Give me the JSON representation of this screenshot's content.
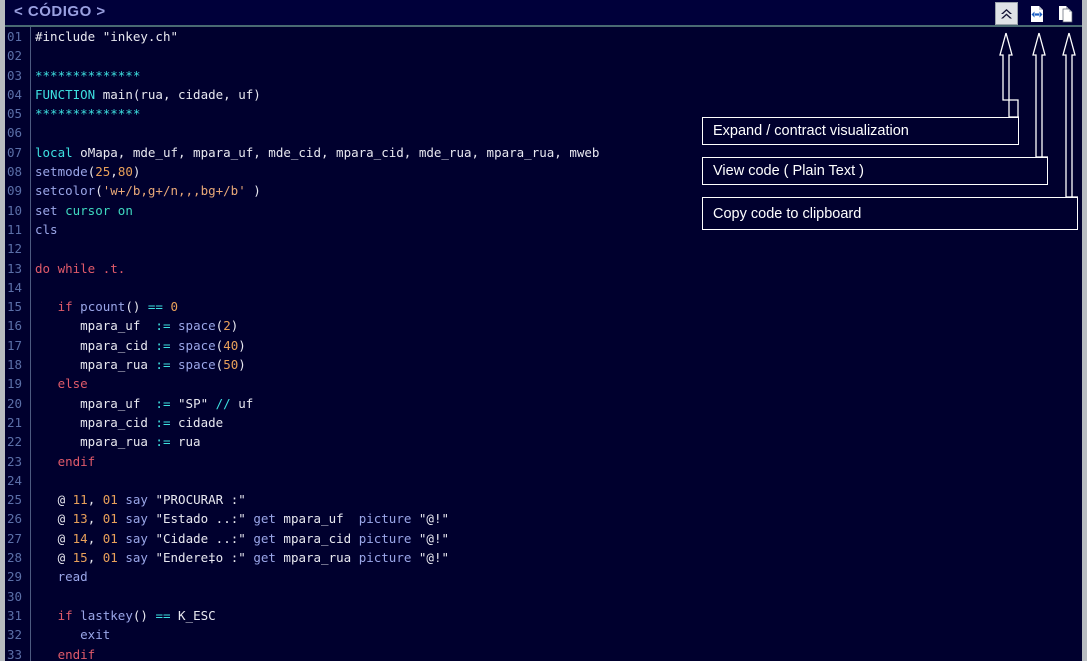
{
  "window": {
    "title": "< CÓDIGO >",
    "background_color": "#00002e",
    "title_color": "#9aa0e0",
    "border_color": "#b8bcc0"
  },
  "toolbar": {
    "buttons": [
      {
        "name": "expand-contract-button",
        "icon": "double-chevron-up-icon",
        "tooltip": "Expand / contract visualization"
      },
      {
        "name": "view-plain-text-button",
        "icon": "code-page-icon",
        "tooltip": "View code ( Plain Text )"
      },
      {
        "name": "copy-clipboard-button",
        "icon": "copy-pages-icon",
        "tooltip": "Copy code to clipboard"
      }
    ]
  },
  "callouts": [
    {
      "id": "callout-1",
      "label": "Expand / contract visualization"
    },
    {
      "id": "callout-2",
      "label": "View code ( Plain Text )"
    },
    {
      "id": "callout-3",
      "label": "Copy code to clipboard"
    }
  ],
  "editor": {
    "language": "Clipper / Harbour",
    "line_number_color": "#5b6fa8",
    "lines": [
      {
        "n": "01",
        "tokens": [
          {
            "t": "#include ",
            "c": "pl"
          },
          {
            "t": "\"inkey.ch\"",
            "c": "str"
          }
        ]
      },
      {
        "n": "02",
        "tokens": []
      },
      {
        "n": "03",
        "tokens": [
          {
            "t": "**************",
            "c": "cy"
          }
        ]
      },
      {
        "n": "04",
        "tokens": [
          {
            "t": "FUNCTION",
            "c": "cy"
          },
          {
            "t": " main(rua, cidade, uf)",
            "c": "pl"
          }
        ]
      },
      {
        "n": "05",
        "tokens": [
          {
            "t": "**************",
            "c": "cy"
          }
        ]
      },
      {
        "n": "06",
        "tokens": []
      },
      {
        "n": "07",
        "tokens": [
          {
            "t": "local",
            "c": "cy"
          },
          {
            "t": " oMapa, mde_uf, mpara_uf, mde_cid, mpara_cid, mde_rua, mpara_rua, mweb",
            "c": "pl"
          }
        ]
      },
      {
        "n": "08",
        "tokens": [
          {
            "t": "setmode",
            "c": "fn"
          },
          {
            "t": "(",
            "c": "pl"
          },
          {
            "t": "25",
            "c": "num"
          },
          {
            "t": ",",
            "c": "pl"
          },
          {
            "t": "80",
            "c": "num"
          },
          {
            "t": ")",
            "c": "pl"
          }
        ]
      },
      {
        "n": "09",
        "tokens": [
          {
            "t": "setcolor",
            "c": "fn"
          },
          {
            "t": "(",
            "c": "pl"
          },
          {
            "t": "'w+/b,g+/n,,,bg+/b'",
            "c": "str2"
          },
          {
            "t": " )",
            "c": "pl"
          }
        ]
      },
      {
        "n": "10",
        "tokens": [
          {
            "t": "set",
            "c": "fn"
          },
          {
            "t": " ",
            "c": "pl"
          },
          {
            "t": "cursor on",
            "c": "tl"
          }
        ]
      },
      {
        "n": "11",
        "tokens": [
          {
            "t": "cls",
            "c": "fn"
          }
        ]
      },
      {
        "n": "12",
        "tokens": []
      },
      {
        "n": "13",
        "tokens": [
          {
            "t": "do while",
            "c": "kw"
          },
          {
            "t": " ",
            "c": "pl"
          },
          {
            "t": ".t.",
            "c": "kw"
          }
        ]
      },
      {
        "n": "14",
        "tokens": []
      },
      {
        "n": "15",
        "tokens": [
          {
            "t": "   ",
            "c": "pl"
          },
          {
            "t": "if",
            "c": "kw"
          },
          {
            "t": " ",
            "c": "pl"
          },
          {
            "t": "pcount",
            "c": "fn"
          },
          {
            "t": "() ",
            "c": "pl"
          },
          {
            "t": "==",
            "c": "cy"
          },
          {
            "t": " ",
            "c": "pl"
          },
          {
            "t": "0",
            "c": "num"
          }
        ]
      },
      {
        "n": "16",
        "tokens": [
          {
            "t": "      mpara_uf  ",
            "c": "pl"
          },
          {
            "t": ":=",
            "c": "cy"
          },
          {
            "t": " ",
            "c": "pl"
          },
          {
            "t": "space",
            "c": "fn"
          },
          {
            "t": "(",
            "c": "pl"
          },
          {
            "t": "2",
            "c": "num"
          },
          {
            "t": ")",
            "c": "pl"
          }
        ]
      },
      {
        "n": "17",
        "tokens": [
          {
            "t": "      mpara_cid ",
            "c": "pl"
          },
          {
            "t": ":=",
            "c": "cy"
          },
          {
            "t": " ",
            "c": "pl"
          },
          {
            "t": "space",
            "c": "fn"
          },
          {
            "t": "(",
            "c": "pl"
          },
          {
            "t": "40",
            "c": "num"
          },
          {
            "t": ")",
            "c": "pl"
          }
        ]
      },
      {
        "n": "18",
        "tokens": [
          {
            "t": "      mpara_rua ",
            "c": "pl"
          },
          {
            "t": ":=",
            "c": "cy"
          },
          {
            "t": " ",
            "c": "pl"
          },
          {
            "t": "space",
            "c": "fn"
          },
          {
            "t": "(",
            "c": "pl"
          },
          {
            "t": "50",
            "c": "num"
          },
          {
            "t": ")",
            "c": "pl"
          }
        ]
      },
      {
        "n": "19",
        "tokens": [
          {
            "t": "   ",
            "c": "pl"
          },
          {
            "t": "else",
            "c": "kw"
          }
        ]
      },
      {
        "n": "20",
        "tokens": [
          {
            "t": "      mpara_uf  ",
            "c": "pl"
          },
          {
            "t": ":=",
            "c": "cy"
          },
          {
            "t": " ",
            "c": "pl"
          },
          {
            "t": "\"SP\"",
            "c": "str"
          },
          {
            "t": " ",
            "c": "pl"
          },
          {
            "t": "//",
            "c": "com"
          },
          {
            "t": " uf",
            "c": "pl"
          }
        ]
      },
      {
        "n": "21",
        "tokens": [
          {
            "t": "      mpara_cid ",
            "c": "pl"
          },
          {
            "t": ":=",
            "c": "cy"
          },
          {
            "t": " cidade",
            "c": "pl"
          }
        ]
      },
      {
        "n": "22",
        "tokens": [
          {
            "t": "      mpara_rua ",
            "c": "pl"
          },
          {
            "t": ":=",
            "c": "cy"
          },
          {
            "t": " rua",
            "c": "pl"
          }
        ]
      },
      {
        "n": "23",
        "tokens": [
          {
            "t": "   ",
            "c": "pl"
          },
          {
            "t": "endif",
            "c": "kw"
          }
        ]
      },
      {
        "n": "24",
        "tokens": []
      },
      {
        "n": "25",
        "tokens": [
          {
            "t": "   @ ",
            "c": "pl"
          },
          {
            "t": "11",
            "c": "num"
          },
          {
            "t": ", ",
            "c": "pl"
          },
          {
            "t": "01",
            "c": "num"
          },
          {
            "t": " ",
            "c": "pl"
          },
          {
            "t": "say",
            "c": "fn"
          },
          {
            "t": " ",
            "c": "pl"
          },
          {
            "t": "\"PROCURAR :\"",
            "c": "str"
          }
        ]
      },
      {
        "n": "26",
        "tokens": [
          {
            "t": "   @ ",
            "c": "pl"
          },
          {
            "t": "13",
            "c": "num"
          },
          {
            "t": ", ",
            "c": "pl"
          },
          {
            "t": "01",
            "c": "num"
          },
          {
            "t": " ",
            "c": "pl"
          },
          {
            "t": "say",
            "c": "fn"
          },
          {
            "t": " ",
            "c": "pl"
          },
          {
            "t": "\"Estado ..:\"",
            "c": "str"
          },
          {
            "t": " ",
            "c": "pl"
          },
          {
            "t": "get",
            "c": "fn"
          },
          {
            "t": " mpara_uf  ",
            "c": "pl"
          },
          {
            "t": "picture",
            "c": "fn"
          },
          {
            "t": " ",
            "c": "pl"
          },
          {
            "t": "\"@!\"",
            "c": "str"
          }
        ]
      },
      {
        "n": "27",
        "tokens": [
          {
            "t": "   @ ",
            "c": "pl"
          },
          {
            "t": "14",
            "c": "num"
          },
          {
            "t": ", ",
            "c": "pl"
          },
          {
            "t": "01",
            "c": "num"
          },
          {
            "t": " ",
            "c": "pl"
          },
          {
            "t": "say",
            "c": "fn"
          },
          {
            "t": " ",
            "c": "pl"
          },
          {
            "t": "\"Cidade ..:\"",
            "c": "str"
          },
          {
            "t": " ",
            "c": "pl"
          },
          {
            "t": "get",
            "c": "fn"
          },
          {
            "t": " mpara_cid ",
            "c": "pl"
          },
          {
            "t": "picture",
            "c": "fn"
          },
          {
            "t": " ",
            "c": "pl"
          },
          {
            "t": "\"@!\"",
            "c": "str"
          }
        ]
      },
      {
        "n": "28",
        "tokens": [
          {
            "t": "   @ ",
            "c": "pl"
          },
          {
            "t": "15",
            "c": "num"
          },
          {
            "t": ", ",
            "c": "pl"
          },
          {
            "t": "01",
            "c": "num"
          },
          {
            "t": " ",
            "c": "pl"
          },
          {
            "t": "say",
            "c": "fn"
          },
          {
            "t": " ",
            "c": "pl"
          },
          {
            "t": "\"Endere‡o :\"",
            "c": "str"
          },
          {
            "t": " ",
            "c": "pl"
          },
          {
            "t": "get",
            "c": "fn"
          },
          {
            "t": " mpara_rua ",
            "c": "pl"
          },
          {
            "t": "picture",
            "c": "fn"
          },
          {
            "t": " ",
            "c": "pl"
          },
          {
            "t": "\"@!\"",
            "c": "str"
          }
        ]
      },
      {
        "n": "29",
        "tokens": [
          {
            "t": "   ",
            "c": "pl"
          },
          {
            "t": "read",
            "c": "fn"
          }
        ]
      },
      {
        "n": "30",
        "tokens": []
      },
      {
        "n": "31",
        "tokens": [
          {
            "t": "   ",
            "c": "pl"
          },
          {
            "t": "if",
            "c": "kw"
          },
          {
            "t": " ",
            "c": "pl"
          },
          {
            "t": "lastkey",
            "c": "fn"
          },
          {
            "t": "() ",
            "c": "pl"
          },
          {
            "t": "==",
            "c": "cy"
          },
          {
            "t": " K_ESC",
            "c": "pl"
          }
        ]
      },
      {
        "n": "32",
        "tokens": [
          {
            "t": "      ",
            "c": "pl"
          },
          {
            "t": "exit",
            "c": "fn"
          }
        ]
      },
      {
        "n": "33",
        "tokens": [
          {
            "t": "   ",
            "c": "pl"
          },
          {
            "t": "endif",
            "c": "kw"
          }
        ]
      }
    ]
  }
}
